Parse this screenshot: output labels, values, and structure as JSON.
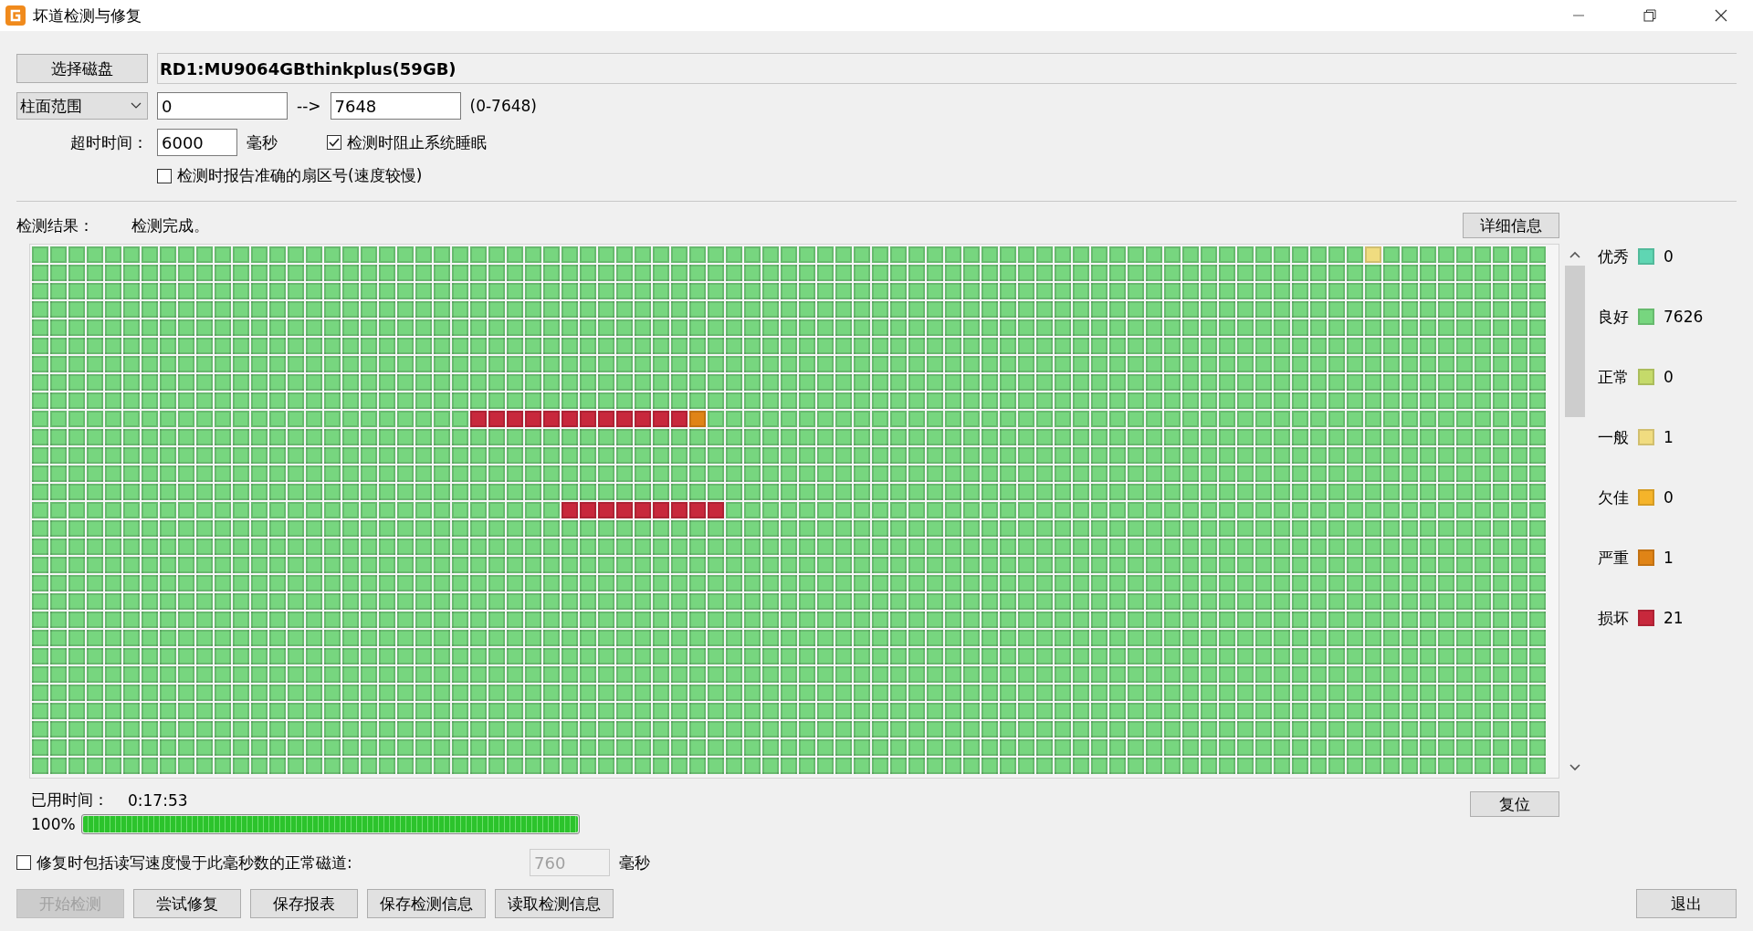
{
  "window": {
    "title": "坏道检测与修复"
  },
  "disk": {
    "button": "选择磁盘",
    "name": "RD1:MU9064GBthinkplus(59GB)"
  },
  "range": {
    "mode": "柱面范围",
    "from": "0",
    "arrow": "-->",
    "to": "7648",
    "limits": "(0-7648)"
  },
  "timeout": {
    "label": "超时时间：",
    "value": "6000",
    "unit": "毫秒"
  },
  "options": [
    {
      "label": "检测时阻止系统睡眠",
      "checked": true
    },
    {
      "label": "检测时报告准确的扇区号(速度较慢)",
      "checked": false
    }
  ],
  "result": {
    "label": "检测结果：",
    "status": "检测完成。",
    "details_button": "详细信息"
  },
  "legend": [
    {
      "name": "优秀",
      "color": "#5fd6b3",
      "count": "0"
    },
    {
      "name": "良好",
      "color": "#77d67f",
      "count": "7626"
    },
    {
      "name": "正常",
      "color": "#c5da6a",
      "count": "0"
    },
    {
      "name": "一般",
      "color": "#f0dc80",
      "count": "1"
    },
    {
      "name": "欠佳",
      "color": "#f5b42a",
      "count": "0"
    },
    {
      "name": "严重",
      "color": "#e08416",
      "count": "1"
    },
    {
      "name": "损坏",
      "color": "#c8283c",
      "count": "21"
    }
  ],
  "block_rows": [
    {
      "cells": [
        {
          "color": "#77d67f"
        },
        {
          "color": "#77d67f"
        },
        {
          "color": "#77d67f"
        },
        {
          "color": "#77d67f"
        },
        {
          "color": "#77d67f"
        },
        {
          "color": "#77d67f"
        },
        {
          "color": "#77d67f"
        },
        {
          "color": "#77d67f"
        },
        {
          "color": "#77d67f"
        },
        {
          "color": "#77d67f"
        },
        {
          "color": "#77d67f"
        },
        {
          "color": "#77d67f"
        },
        {
          "color": "#77d67f"
        },
        {
          "color": "#77d67f"
        },
        {
          "color": "#77d67f"
        },
        {
          "color": "#77d67f"
        },
        {
          "color": "#77d67f"
        },
        {
          "color": "#77d67f"
        },
        {
          "color": "#77d67f"
        },
        {
          "color": "#77d67f"
        },
        {
          "color": "#77d67f"
        },
        {
          "color": "#77d67f"
        },
        {
          "color": "#77d67f"
        },
        {
          "color": "#77d67f"
        },
        {
          "color": "#77d67f"
        },
        {
          "color": "#77d67f"
        },
        {
          "color": "#77d67f"
        },
        {
          "color": "#77d67f"
        },
        {
          "color": "#77d67f"
        },
        {
          "color": "#77d67f"
        },
        {
          "color": "#77d67f"
        },
        {
          "color": "#77d67f"
        },
        {
          "color": "#77d67f"
        },
        {
          "color": "#77d67f"
        },
        {
          "color": "#77d67f"
        },
        {
          "color": "#77d67f"
        },
        {
          "color": "#77d67f"
        },
        {
          "color": "#77d67f"
        },
        {
          "color": "#77d67f"
        },
        {
          "color": "#77d67f"
        },
        {
          "color": "#77d67f"
        },
        {
          "color": "#77d67f"
        },
        {
          "color": "#77d67f"
        },
        {
          "color": "#77d67f"
        },
        {
          "color": "#77d67f"
        },
        {
          "color": "#77d67f"
        },
        {
          "color": "#77d67f"
        },
        {
          "color": "#77d67f"
        },
        {
          "color": "#77d67f"
        },
        {
          "color": "#77d67f"
        },
        {
          "color": "#77d67f"
        },
        {
          "color": "#77d67f"
        },
        {
          "color": "#77d67f"
        },
        {
          "color": "#77d67f"
        },
        {
          "color": "#77d67f"
        },
        {
          "color": "#77d67f"
        },
        {
          "color": "#77d67f"
        },
        {
          "color": "#77d67f"
        },
        {
          "color": "#77d67f"
        },
        {
          "color": "#77d67f"
        },
        {
          "color": "#77d67f"
        },
        {
          "color": "#77d67f"
        },
        {
          "color": "#77d67f"
        },
        {
          "color": "#77d67f"
        },
        {
          "color": "#77d67f"
        },
        {
          "color": "#77d67f"
        },
        {
          "color": "#77d67f"
        },
        {
          "color": "#77d67f"
        },
        {
          "color": "#77d67f"
        },
        {
          "color": "#77d67f"
        },
        {
          "color": "#77d67f"
        },
        {
          "color": "#77d67f"
        },
        {
          "color": "#77d67f"
        },
        {
          "color": "#f0dc80"
        },
        {
          "color": "#77d67f"
        },
        {
          "color": "#77d67f"
        },
        {
          "color": "#77d67f"
        },
        {
          "color": "#77d67f"
        },
        {
          "color": "#77d67f"
        },
        {
          "color": "#77d67f"
        },
        {
          "color": "#77d67f"
        },
        {
          "color": "#77d67f"
        },
        {
          "color": "#77d67f"
        }
      ]
    },
    {
      "color": "#77d67f"
    },
    {
      "color": "#77d67f"
    },
    {
      "color": "#77d67f"
    },
    {
      "color": "#77d67f"
    },
    {
      "color": "#77d67f"
    },
    {
      "color": "#77d67f"
    },
    {
      "color": "#77d67f"
    },
    {
      "color": "#77d67f"
    },
    {
      "cells": [
        {
          "color": "#77d67f"
        },
        {
          "color": "#77d67f"
        },
        {
          "color": "#77d67f"
        },
        {
          "color": "#77d67f"
        },
        {
          "color": "#77d67f"
        },
        {
          "color": "#77d67f"
        },
        {
          "color": "#77d67f"
        },
        {
          "color": "#77d67f"
        },
        {
          "color": "#77d67f"
        },
        {
          "color": "#77d67f"
        },
        {
          "color": "#77d67f"
        },
        {
          "color": "#77d67f"
        },
        {
          "color": "#77d67f"
        },
        {
          "color": "#77d67f"
        },
        {
          "color": "#77d67f"
        },
        {
          "color": "#77d67f"
        },
        {
          "color": "#77d67f"
        },
        {
          "color": "#77d67f"
        },
        {
          "color": "#77d67f"
        },
        {
          "color": "#77d67f"
        },
        {
          "color": "#77d67f"
        },
        {
          "color": "#77d67f"
        },
        {
          "color": "#77d67f"
        },
        {
          "color": "#77d67f"
        },
        {
          "color": "#c8283c"
        },
        {
          "color": "#c8283c"
        },
        {
          "color": "#c8283c"
        },
        {
          "color": "#c8283c"
        },
        {
          "color": "#c8283c"
        },
        {
          "color": "#c8283c"
        },
        {
          "color": "#c8283c"
        },
        {
          "color": "#c8283c"
        },
        {
          "color": "#c8283c"
        },
        {
          "color": "#c8283c"
        },
        {
          "color": "#c8283c"
        },
        {
          "color": "#c8283c"
        },
        {
          "color": "#e08416"
        },
        {
          "color": "#77d67f"
        },
        {
          "color": "#77d67f"
        },
        {
          "color": "#77d67f"
        },
        {
          "color": "#77d67f"
        },
        {
          "color": "#77d67f"
        },
        {
          "color": "#77d67f"
        },
        {
          "color": "#77d67f"
        },
        {
          "color": "#77d67f"
        },
        {
          "color": "#77d67f"
        },
        {
          "color": "#77d67f"
        },
        {
          "color": "#77d67f"
        },
        {
          "color": "#77d67f"
        },
        {
          "color": "#77d67f"
        },
        {
          "color": "#77d67f"
        },
        {
          "color": "#77d67f"
        },
        {
          "color": "#77d67f"
        },
        {
          "color": "#77d67f"
        },
        {
          "color": "#77d67f"
        },
        {
          "color": "#77d67f"
        },
        {
          "color": "#77d67f"
        },
        {
          "color": "#77d67f"
        },
        {
          "color": "#77d67f"
        },
        {
          "color": "#77d67f"
        },
        {
          "color": "#77d67f"
        },
        {
          "color": "#77d67f"
        },
        {
          "color": "#77d67f"
        },
        {
          "color": "#77d67f"
        },
        {
          "color": "#77d67f"
        },
        {
          "color": "#77d67f"
        },
        {
          "color": "#77d67f"
        },
        {
          "color": "#77d67f"
        },
        {
          "color": "#77d67f"
        },
        {
          "color": "#77d67f"
        },
        {
          "color": "#77d67f"
        },
        {
          "color": "#77d67f"
        },
        {
          "color": "#77d67f"
        },
        {
          "color": "#77d67f"
        },
        {
          "color": "#77d67f"
        },
        {
          "color": "#77d67f"
        },
        {
          "color": "#77d67f"
        },
        {
          "color": "#77d67f"
        },
        {
          "color": "#77d67f"
        },
        {
          "color": "#77d67f"
        },
        {
          "color": "#77d67f"
        },
        {
          "color": "#77d67f"
        },
        {
          "color": "#77d67f"
        }
      ]
    },
    {
      "color": "#77d67f"
    },
    {
      "color": "#77d67f"
    },
    {
      "color": "#77d67f"
    },
    {
      "color": "#77d67f"
    },
    {
      "cells": [
        {
          "color": "#77d67f"
        },
        {
          "color": "#77d67f"
        },
        {
          "color": "#77d67f"
        },
        {
          "color": "#77d67f"
        },
        {
          "color": "#77d67f"
        },
        {
          "color": "#77d67f"
        },
        {
          "color": "#77d67f"
        },
        {
          "color": "#77d67f"
        },
        {
          "color": "#77d67f"
        },
        {
          "color": "#77d67f"
        },
        {
          "color": "#77d67f"
        },
        {
          "color": "#77d67f"
        },
        {
          "color": "#77d67f"
        },
        {
          "color": "#77d67f"
        },
        {
          "color": "#77d67f"
        },
        {
          "color": "#77d67f"
        },
        {
          "color": "#77d67f"
        },
        {
          "color": "#77d67f"
        },
        {
          "color": "#77d67f"
        },
        {
          "color": "#77d67f"
        },
        {
          "color": "#77d67f"
        },
        {
          "color": "#77d67f"
        },
        {
          "color": "#77d67f"
        },
        {
          "color": "#77d67f"
        },
        {
          "color": "#77d67f"
        },
        {
          "color": "#77d67f"
        },
        {
          "color": "#77d67f"
        },
        {
          "color": "#77d67f"
        },
        {
          "color": "#77d67f"
        },
        {
          "color": "#c8283c"
        },
        {
          "color": "#c8283c"
        },
        {
          "color": "#c8283c"
        },
        {
          "color": "#c8283c"
        },
        {
          "color": "#c8283c"
        },
        {
          "color": "#c8283c"
        },
        {
          "color": "#c8283c"
        },
        {
          "color": "#c8283c"
        },
        {
          "color": "#c8283c"
        },
        {
          "color": "#77d67f"
        },
        {
          "color": "#77d67f"
        },
        {
          "color": "#77d67f"
        },
        {
          "color": "#77d67f"
        },
        {
          "color": "#77d67f"
        },
        {
          "color": "#77d67f"
        },
        {
          "color": "#77d67f"
        },
        {
          "color": "#77d67f"
        },
        {
          "color": "#77d67f"
        },
        {
          "color": "#77d67f"
        },
        {
          "color": "#77d67f"
        },
        {
          "color": "#77d67f"
        },
        {
          "color": "#77d67f"
        },
        {
          "color": "#77d67f"
        },
        {
          "color": "#77d67f"
        },
        {
          "color": "#77d67f"
        },
        {
          "color": "#77d67f"
        },
        {
          "color": "#77d67f"
        },
        {
          "color": "#77d67f"
        },
        {
          "color": "#77d67f"
        },
        {
          "color": "#77d67f"
        },
        {
          "color": "#77d67f"
        },
        {
          "color": "#77d67f"
        },
        {
          "color": "#77d67f"
        },
        {
          "color": "#77d67f"
        },
        {
          "color": "#77d67f"
        },
        {
          "color": "#77d67f"
        },
        {
          "color": "#77d67f"
        },
        {
          "color": "#77d67f"
        },
        {
          "color": "#77d67f"
        },
        {
          "color": "#77d67f"
        },
        {
          "color": "#77d67f"
        },
        {
          "color": "#77d67f"
        },
        {
          "color": "#77d67f"
        },
        {
          "color": "#77d67f"
        },
        {
          "color": "#77d67f"
        },
        {
          "color": "#77d67f"
        },
        {
          "color": "#77d67f"
        },
        {
          "color": "#77d67f"
        },
        {
          "color": "#77d67f"
        },
        {
          "color": "#77d67f"
        },
        {
          "color": "#77d67f"
        },
        {
          "color": "#77d67f"
        },
        {
          "color": "#77d67f"
        },
        {
          "color": "#77d67f"
        }
      ]
    },
    {
      "color": "#77d67f"
    },
    {
      "color": "#77d67f"
    },
    {
      "color": "#77d67f"
    },
    {
      "color": "#77d67f"
    },
    {
      "color": "#77d67f"
    },
    {
      "color": "#77d67f"
    },
    {
      "color": "#77d67f"
    },
    {
      "color": "#77d67f"
    },
    {
      "color": "#77d67f"
    },
    {
      "color": "#77d67f"
    },
    {
      "color": "#77d67f"
    },
    {
      "color": "#77d67f"
    },
    {
      "color": "#77d67f"
    },
    {
      "color": "#77d67f"
    }
  ],
  "elapsed": {
    "label": "已用时间：",
    "value": "0:17:53"
  },
  "progress": {
    "percent": "100%",
    "level": 1
  },
  "reset_button": "复位",
  "slow_repair": {
    "label": "修复时包括读写速度慢于此毫秒数的正常磁道:",
    "checked": false,
    "value": "760",
    "disabled": true,
    "unit": "毫秒"
  },
  "buttons": [
    {
      "label": "开始检测",
      "disabled": true
    },
    {
      "label": "尝试修复",
      "disabled": false
    },
    {
      "label": "保存报表",
      "disabled": false
    },
    {
      "label": "保存检测信息",
      "disabled": false
    },
    {
      "label": "读取检测信息",
      "disabled": false
    }
  ],
  "exit_button": "退出"
}
